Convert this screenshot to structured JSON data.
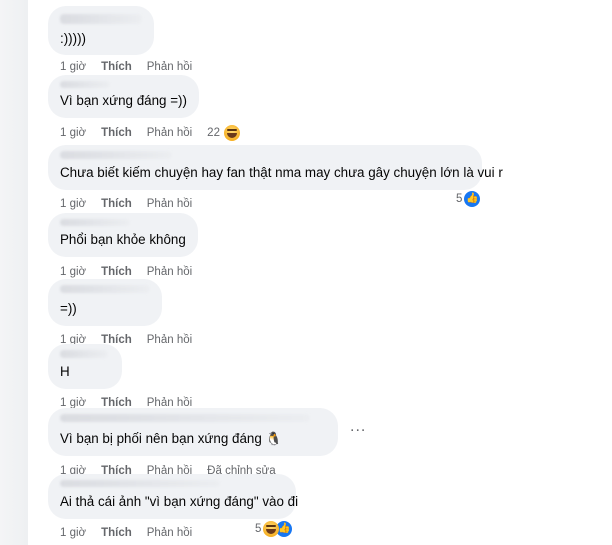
{
  "labels": {
    "like": "Thích",
    "reply": "Phản hồi",
    "time": "1 giờ",
    "edited": "Đã chỉnh sửa"
  },
  "comments": [
    {
      "text": ":)))))"
    },
    {
      "text": "Vì bạn xứng đáng =))",
      "reaction_count": "22",
      "reaction": "haha-icon"
    },
    {
      "text": "Chưa biết kiếm chuyện hay fan thật nma may chưa gây chuyện lớn là vui r",
      "reaction_count": "5",
      "reaction": "like-icon"
    },
    {
      "text": "Phổi bạn khỏe không"
    },
    {
      "text": "=))"
    },
    {
      "text": "H"
    },
    {
      "text": "Vì bạn bị phối nên bạn xứng đáng",
      "emoji": "🐧",
      "more": "..."
    },
    {
      "text": "Ai thả cái ảnh \"vì bạn xứng đáng\" vào đi",
      "reaction_count": "5",
      "reaction": "haha-like-icons"
    }
  ],
  "colors": {
    "bubble": "#f0f2f5",
    "meta": "#65676b",
    "like_blue": "#1877f2"
  }
}
